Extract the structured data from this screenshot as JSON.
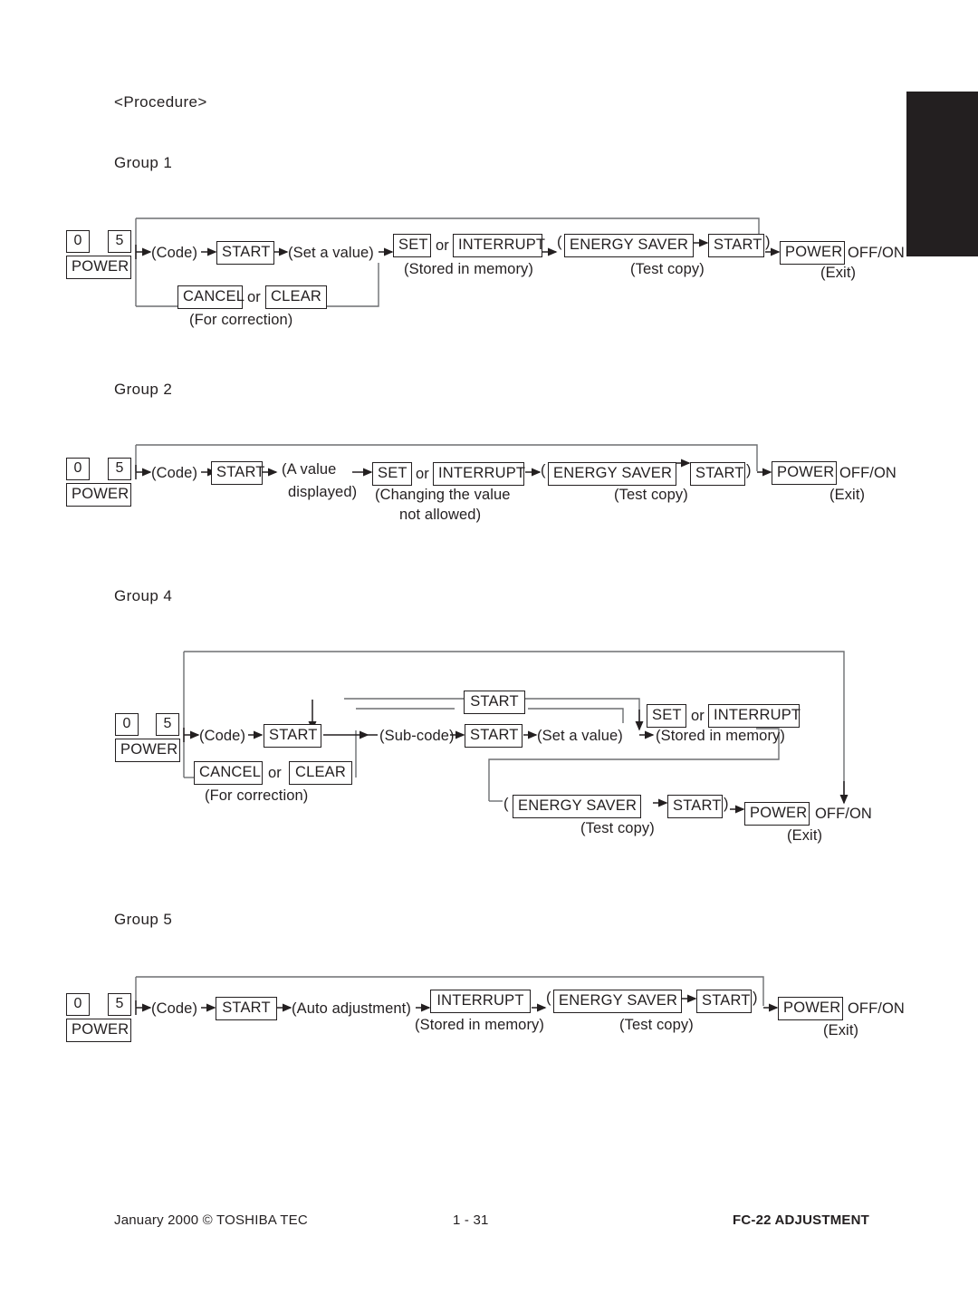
{
  "document": {
    "procedure_heading": "<Procedure>",
    "footer": {
      "left": "January 2000 © TOSHIBA TEC",
      "center": "1 - 31",
      "right": "FC-22 ADJUSTMENT"
    },
    "colors": {
      "ink": "#231f20",
      "tab_mark": "#231f20",
      "line": "#6d6e71",
      "page_background": "#ffffff"
    }
  },
  "groups": [
    {
      "label": "Group 1",
      "nodes": {
        "key_0": "0",
        "key_5": "5",
        "key_power": "POWER",
        "code": "(Code)",
        "start": "START",
        "set_value": "(Set a value)",
        "set": "SET",
        "or1": "or",
        "interrupt": "INTERRUPT",
        "stored": "(Stored in memory)",
        "paren_open": "(",
        "energy_saver": "ENERGY SAVER",
        "start2": "START",
        "paren_close": ")",
        "test_copy": "(Test copy)",
        "power_exit": "POWER",
        "offon": "OFF/ON",
        "exit": "(Exit)",
        "cancel": "CANCEL",
        "or2": "or",
        "clear": "CLEAR",
        "for_correction": "(For correction)"
      }
    },
    {
      "label": "Group 2",
      "nodes": {
        "key_0": "0",
        "key_5": "5",
        "key_power": "POWER",
        "code": "(Code)",
        "start": "START",
        "value_displayed_l1": "(A value",
        "value_displayed_l2": "displayed)",
        "set": "SET",
        "or1": "or",
        "interrupt": "INTERRUPT",
        "changing_l1": "(Changing the value",
        "changing_l2": "not allowed)",
        "paren_open": "(",
        "energy_saver": "ENERGY SAVER",
        "start2": "START",
        "paren_close": ")",
        "test_copy": "(Test copy)",
        "power_exit": "POWER",
        "offon": "OFF/ON",
        "exit": "(Exit)"
      }
    },
    {
      "label": "Group 4",
      "nodes": {
        "key_0": "0",
        "key_5": "5",
        "key_power": "POWER",
        "code": "(Code)",
        "start": "START",
        "cancel": "CANCEL",
        "or2": "or",
        "clear": "CLEAR",
        "for_correction": "(For correction)",
        "subcode": "(Sub-code)",
        "start_sub": "START",
        "start_top": "START",
        "set_value": "(Set a value)",
        "set": "SET",
        "or1": "or",
        "interrupt": "INTERRUPT",
        "stored": "(Stored in memory)",
        "paren_open": "(",
        "energy_saver": "ENERGY SAVER",
        "start2": "START",
        "paren_close": ")",
        "test_copy": "(Test copy)",
        "power_exit": "POWER",
        "offon": "OFF/ON",
        "exit": "(Exit)"
      }
    },
    {
      "label": "Group 5",
      "nodes": {
        "key_0": "0",
        "key_5": "5",
        "key_power": "POWER",
        "code": "(Code)",
        "start": "START",
        "auto_adjustment": "(Auto adjustment)",
        "interrupt": "INTERRUPT",
        "stored": "(Stored in memory)",
        "paren_open": "(",
        "energy_saver": "ENERGY SAVER",
        "start2": "START",
        "paren_close": ")",
        "test_copy": "(Test copy)",
        "power_exit": "POWER",
        "offon": "OFF/ON",
        "exit": "(Exit)"
      }
    }
  ]
}
